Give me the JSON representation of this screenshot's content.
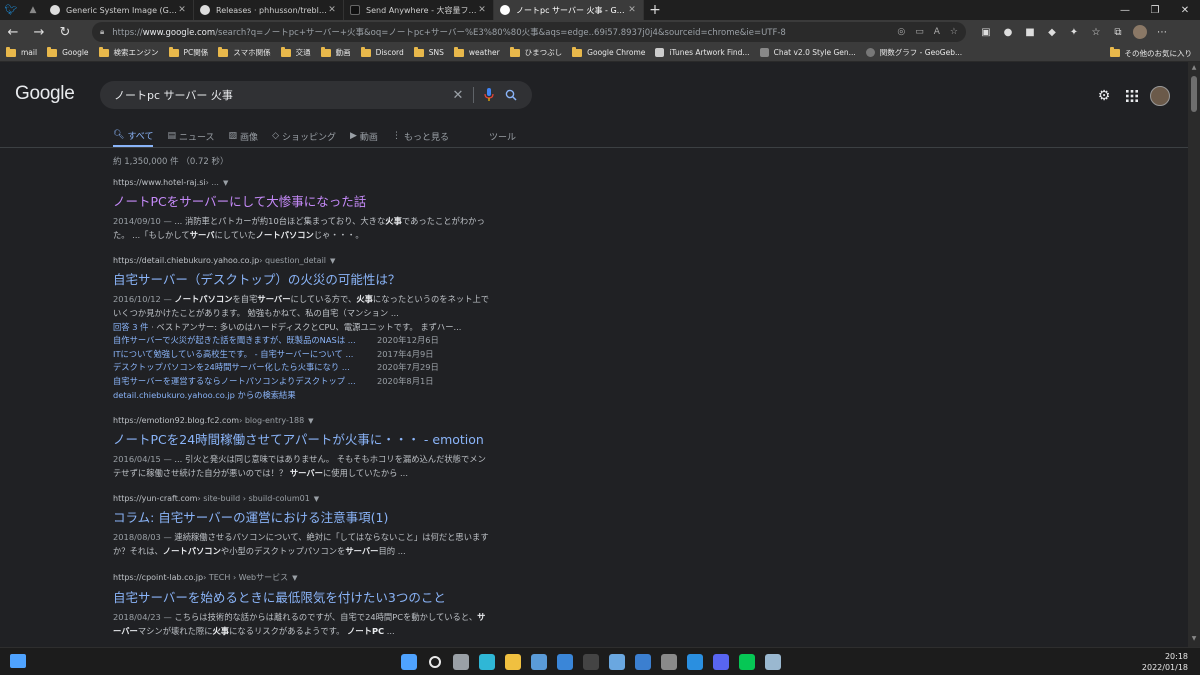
{
  "browser": {
    "pinned_tabs": [
      "twitter-icon",
      "app-icon"
    ],
    "tabs": [
      {
        "title": "Generic System Image (GSI) list",
        "favicon": "github-icon",
        "active": false
      },
      {
        "title": "Releases · phhusson/treble_exp",
        "favicon": "github-icon",
        "active": false
      },
      {
        "title": "Send Anywhere - 大容量ファイル転送",
        "favicon": "send-anywhere-icon",
        "active": false
      },
      {
        "title": "ノートpc サーバー 火事 - Google 検索",
        "favicon": "google-icon",
        "active": true
      }
    ],
    "url_prefix": "https://",
    "url_host": "www.google.com",
    "url_rest": "/search?q=ノートpc+サーバー+火事&oq=ノートpc+サーバー%E3%80%80火事&aqs=edge..69i57.8937j0j4&sourceid=chrome&ie=UTF-8",
    "bookmarks": [
      {
        "label": "mail",
        "type": "folder"
      },
      {
        "label": "Google",
        "type": "folder"
      },
      {
        "label": "検索エンジン",
        "type": "folder"
      },
      {
        "label": "PC関係",
        "type": "folder"
      },
      {
        "label": "スマホ関係",
        "type": "folder"
      },
      {
        "label": "交通",
        "type": "folder"
      },
      {
        "label": "動画",
        "type": "folder"
      },
      {
        "label": "Discord",
        "type": "folder"
      },
      {
        "label": "SNS",
        "type": "folder"
      },
      {
        "label": "weather",
        "type": "folder"
      },
      {
        "label": "ひまつぶし",
        "type": "folder"
      },
      {
        "label": "Google Chrome",
        "type": "folder"
      },
      {
        "label": "iTunes Artwork Find...",
        "type": "site"
      },
      {
        "label": "Chat v2.0 Style Gen...",
        "type": "site"
      },
      {
        "label": "関数グラフ - GeoGeb...",
        "type": "site"
      }
    ],
    "other_bookmarks": "その他のお気に入り"
  },
  "google": {
    "logo": "Google",
    "query": "ノートpc サーバー 火事",
    "tabs": [
      {
        "label": "すべて",
        "icon": "search-icon",
        "active": true
      },
      {
        "label": "ニュース",
        "icon": "news-icon",
        "active": false
      },
      {
        "label": "画像",
        "icon": "image-icon",
        "active": false
      },
      {
        "label": "ショッピング",
        "icon": "tag-icon",
        "active": false
      },
      {
        "label": "動画",
        "icon": "video-icon",
        "active": false
      },
      {
        "label": "もっと見る",
        "icon": "more-vert-icon",
        "active": false
      }
    ],
    "tools_label": "ツール",
    "stats": "約 1,350,000 件 （0.72 秒）",
    "results": [
      {
        "cite_host": "https://www.hotel-raj.si",
        "cite_path": " › ...",
        "title": "ノートPCをサーバーにして大惨事になった話",
        "visited": true,
        "date": "2014/09/10 — ",
        "snippet_html": "... 消防車とパトカーが約10台ほど集まっており、大きな<b>火事</b>であったことがわかった。 ...「もしかして<b>サーバ</b>にしていた<b>ノートパソコン</b>じゃ・・・。"
      },
      {
        "cite_host": "https://detail.chiebukuro.yahoo.co.jp",
        "cite_path": " › question_detail",
        "title": "自宅サーバー（デスクトップ）の火災の可能性は？",
        "visited": false,
        "date": "2016/10/12 — ",
        "snippet_html": "<b>ノートパソコン</b>を自宅<b>サーバー</b>にしている方で、<b>火事</b>になったというのをネット上でいくつか見かけたことがあります。 勉強もかねて、私の自宅（マンション ...",
        "answers_link": "回答 3 件",
        "answers_text": " · ベストアンサー: 多いのはハードディスクとCPU、電源ユニットです。 まずハー...",
        "sublinks": [
          {
            "label": "自作サーバーで火災が起きた話を聞きますが、既製品のNASは ...",
            "date": "2020年12月6日"
          },
          {
            "label": "ITについて勉強している高校生です。 - 自宅サーバーについて ...",
            "date": "2017年4月9日"
          },
          {
            "label": "デスクトップパソコンを24時間サーバー化したら火事になり ...",
            "date": "2020年7月29日"
          },
          {
            "label": "自宅サーバーを運営するならノートパソコンよりデスクトップ ...",
            "date": "2020年8月1日"
          }
        ],
        "more_results": "detail.chiebukuro.yahoo.co.jp からの検索結果"
      },
      {
        "cite_host": "https://emotion92.blog.fc2.com",
        "cite_path": " › blog-entry-188",
        "title": "ノートPCを24時間稼働させてアパートが火事に・・・ - emotion",
        "visited": false,
        "date": "2016/04/15 — ",
        "snippet_html": "... 引火と発火は同じ意味ではありません。 そもそもホコリを漏め込んだ状態でメンテせずに稼働させ続けた自分が悪いのでは！？ <b>サーバー</b>に使用していたから ..."
      },
      {
        "cite_host": "https://yun-craft.com",
        "cite_path": " › site-build › sbuild-colum01",
        "title": "コラム: 自宅サーバーの運営における注意事項(1)",
        "visited": false,
        "date": "2018/08/03 — ",
        "snippet_html": "連続稼働させるパソコンについて、絶対に「してはならないこと」は何だと思いますか？それは、<b>ノートパソコン</b>や小型のデスクトップパソコンを<b>サーバー</b>目的 ..."
      },
      {
        "cite_host": "https://cpoint-lab.co.jp",
        "cite_path": " › TECH › Webサービス",
        "title": "自宅サーバーを始めるときに最低限気を付けたい3つのこと",
        "visited": false,
        "date": "2018/04/23 — ",
        "snippet_html": "こちらは技術的な話からは離れるのですが、自宅で24時間PCを動かしていると、<b>サーバー</b>マシンが壊れた際に<b>火事</b>になるリスクがあるようです。 <b>ノートPC</b> ..."
      }
    ]
  },
  "taskbar": {
    "time": "20:18",
    "date": "2022/01/18",
    "apps": [
      {
        "name": "start-icon",
        "color": "#4fa3ff"
      },
      {
        "name": "search-icon",
        "color": "#e8e8e8"
      },
      {
        "name": "task-view-icon",
        "color": "#9aa0a6"
      },
      {
        "name": "edge-icon",
        "color": "#2fb7d6"
      },
      {
        "name": "file-explorer-icon",
        "color": "#f0c040"
      },
      {
        "name": "store-icon",
        "color": "#5a9bd8"
      },
      {
        "name": "mail-icon",
        "color": "#3a86d8"
      },
      {
        "name": "terminal-icon",
        "color": "#444"
      },
      {
        "name": "photos-icon",
        "color": "#6aa7e0"
      },
      {
        "name": "remote-icon",
        "color": "#3b7fd0"
      },
      {
        "name": "settings-icon",
        "color": "#8a8a8a"
      },
      {
        "name": "vscode-icon",
        "color": "#2a8fe0"
      },
      {
        "name": "discord-icon",
        "color": "#5865f2"
      },
      {
        "name": "line-icon",
        "color": "#06c755"
      },
      {
        "name": "image-viewer-icon",
        "color": "#9ab8d0"
      }
    ]
  }
}
